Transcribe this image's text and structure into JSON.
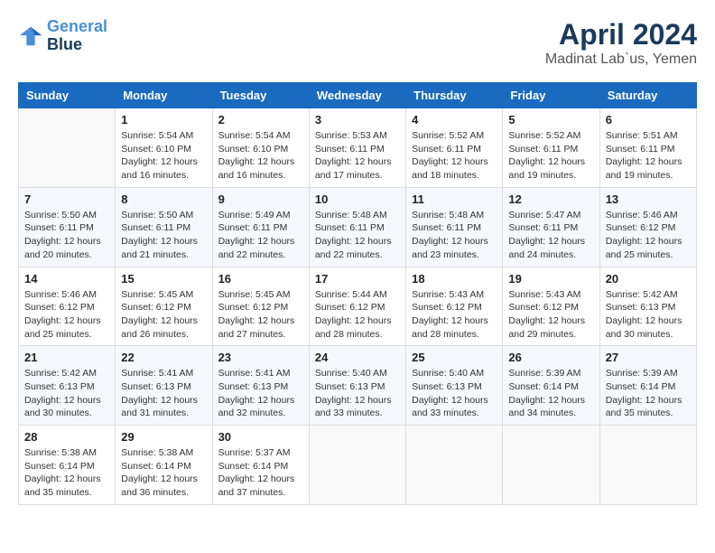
{
  "header": {
    "logo_line1": "General",
    "logo_line2": "Blue",
    "month": "April 2024",
    "location": "Madinat Lab`us, Yemen"
  },
  "weekdays": [
    "Sunday",
    "Monday",
    "Tuesday",
    "Wednesday",
    "Thursday",
    "Friday",
    "Saturday"
  ],
  "weeks": [
    [
      {
        "day": "",
        "sunrise": "",
        "sunset": "",
        "daylight": ""
      },
      {
        "day": "1",
        "sunrise": "Sunrise: 5:54 AM",
        "sunset": "Sunset: 6:10 PM",
        "daylight": "Daylight: 12 hours and 16 minutes."
      },
      {
        "day": "2",
        "sunrise": "Sunrise: 5:54 AM",
        "sunset": "Sunset: 6:10 PM",
        "daylight": "Daylight: 12 hours and 16 minutes."
      },
      {
        "day": "3",
        "sunrise": "Sunrise: 5:53 AM",
        "sunset": "Sunset: 6:11 PM",
        "daylight": "Daylight: 12 hours and 17 minutes."
      },
      {
        "day": "4",
        "sunrise": "Sunrise: 5:52 AM",
        "sunset": "Sunset: 6:11 PM",
        "daylight": "Daylight: 12 hours and 18 minutes."
      },
      {
        "day": "5",
        "sunrise": "Sunrise: 5:52 AM",
        "sunset": "Sunset: 6:11 PM",
        "daylight": "Daylight: 12 hours and 19 minutes."
      },
      {
        "day": "6",
        "sunrise": "Sunrise: 5:51 AM",
        "sunset": "Sunset: 6:11 PM",
        "daylight": "Daylight: 12 hours and 19 minutes."
      }
    ],
    [
      {
        "day": "7",
        "sunrise": "Sunrise: 5:50 AM",
        "sunset": "Sunset: 6:11 PM",
        "daylight": "Daylight: 12 hours and 20 minutes."
      },
      {
        "day": "8",
        "sunrise": "Sunrise: 5:50 AM",
        "sunset": "Sunset: 6:11 PM",
        "daylight": "Daylight: 12 hours and 21 minutes."
      },
      {
        "day": "9",
        "sunrise": "Sunrise: 5:49 AM",
        "sunset": "Sunset: 6:11 PM",
        "daylight": "Daylight: 12 hours and 22 minutes."
      },
      {
        "day": "10",
        "sunrise": "Sunrise: 5:48 AM",
        "sunset": "Sunset: 6:11 PM",
        "daylight": "Daylight: 12 hours and 22 minutes."
      },
      {
        "day": "11",
        "sunrise": "Sunrise: 5:48 AM",
        "sunset": "Sunset: 6:11 PM",
        "daylight": "Daylight: 12 hours and 23 minutes."
      },
      {
        "day": "12",
        "sunrise": "Sunrise: 5:47 AM",
        "sunset": "Sunset: 6:11 PM",
        "daylight": "Daylight: 12 hours and 24 minutes."
      },
      {
        "day": "13",
        "sunrise": "Sunrise: 5:46 AM",
        "sunset": "Sunset: 6:12 PM",
        "daylight": "Daylight: 12 hours and 25 minutes."
      }
    ],
    [
      {
        "day": "14",
        "sunrise": "Sunrise: 5:46 AM",
        "sunset": "Sunset: 6:12 PM",
        "daylight": "Daylight: 12 hours and 25 minutes."
      },
      {
        "day": "15",
        "sunrise": "Sunrise: 5:45 AM",
        "sunset": "Sunset: 6:12 PM",
        "daylight": "Daylight: 12 hours and 26 minutes."
      },
      {
        "day": "16",
        "sunrise": "Sunrise: 5:45 AM",
        "sunset": "Sunset: 6:12 PM",
        "daylight": "Daylight: 12 hours and 27 minutes."
      },
      {
        "day": "17",
        "sunrise": "Sunrise: 5:44 AM",
        "sunset": "Sunset: 6:12 PM",
        "daylight": "Daylight: 12 hours and 28 minutes."
      },
      {
        "day": "18",
        "sunrise": "Sunrise: 5:43 AM",
        "sunset": "Sunset: 6:12 PM",
        "daylight": "Daylight: 12 hours and 28 minutes."
      },
      {
        "day": "19",
        "sunrise": "Sunrise: 5:43 AM",
        "sunset": "Sunset: 6:12 PM",
        "daylight": "Daylight: 12 hours and 29 minutes."
      },
      {
        "day": "20",
        "sunrise": "Sunrise: 5:42 AM",
        "sunset": "Sunset: 6:13 PM",
        "daylight": "Daylight: 12 hours and 30 minutes."
      }
    ],
    [
      {
        "day": "21",
        "sunrise": "Sunrise: 5:42 AM",
        "sunset": "Sunset: 6:13 PM",
        "daylight": "Daylight: 12 hours and 30 minutes."
      },
      {
        "day": "22",
        "sunrise": "Sunrise: 5:41 AM",
        "sunset": "Sunset: 6:13 PM",
        "daylight": "Daylight: 12 hours and 31 minutes."
      },
      {
        "day": "23",
        "sunrise": "Sunrise: 5:41 AM",
        "sunset": "Sunset: 6:13 PM",
        "daylight": "Daylight: 12 hours and 32 minutes."
      },
      {
        "day": "24",
        "sunrise": "Sunrise: 5:40 AM",
        "sunset": "Sunset: 6:13 PM",
        "daylight": "Daylight: 12 hours and 33 minutes."
      },
      {
        "day": "25",
        "sunrise": "Sunrise: 5:40 AM",
        "sunset": "Sunset: 6:13 PM",
        "daylight": "Daylight: 12 hours and 33 minutes."
      },
      {
        "day": "26",
        "sunrise": "Sunrise: 5:39 AM",
        "sunset": "Sunset: 6:14 PM",
        "daylight": "Daylight: 12 hours and 34 minutes."
      },
      {
        "day": "27",
        "sunrise": "Sunrise: 5:39 AM",
        "sunset": "Sunset: 6:14 PM",
        "daylight": "Daylight: 12 hours and 35 minutes."
      }
    ],
    [
      {
        "day": "28",
        "sunrise": "Sunrise: 5:38 AM",
        "sunset": "Sunset: 6:14 PM",
        "daylight": "Daylight: 12 hours and 35 minutes."
      },
      {
        "day": "29",
        "sunrise": "Sunrise: 5:38 AM",
        "sunset": "Sunset: 6:14 PM",
        "daylight": "Daylight: 12 hours and 36 minutes."
      },
      {
        "day": "30",
        "sunrise": "Sunrise: 5:37 AM",
        "sunset": "Sunset: 6:14 PM",
        "daylight": "Daylight: 12 hours and 37 minutes."
      },
      {
        "day": "",
        "sunrise": "",
        "sunset": "",
        "daylight": ""
      },
      {
        "day": "",
        "sunrise": "",
        "sunset": "",
        "daylight": ""
      },
      {
        "day": "",
        "sunrise": "",
        "sunset": "",
        "daylight": ""
      },
      {
        "day": "",
        "sunrise": "",
        "sunset": "",
        "daylight": ""
      }
    ]
  ]
}
